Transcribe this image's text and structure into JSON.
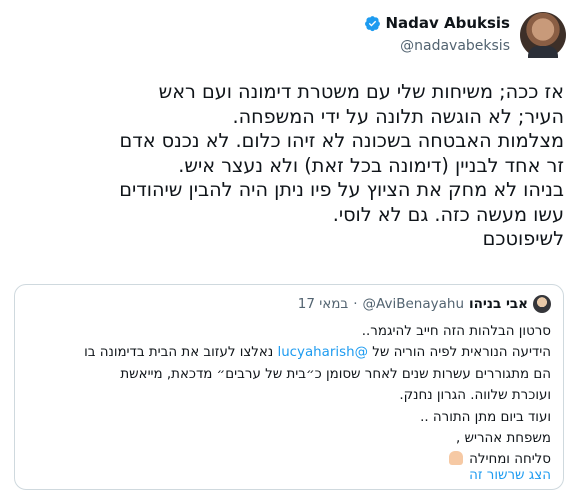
{
  "author": {
    "name": "Nadav Abuksis",
    "handle": "@nadavabeksis"
  },
  "tweet": {
    "lines": [
      "אז ככה; משיחות שלי עם משטרת דימונה ועם ראש",
      "העיר; לא הוגשה תלונה על ידי המשפחה.",
      "מצלמות האבטחה בשכונה לא זיהו כלום. לא נכנס אדם",
      "זר אחד לבניין (דימונה בכל זאת) ולא נעצר איש.",
      "בניהו לא מחק את הציוץ על פיו ניתן היה להבין שיהודים",
      "עשו מעשה כזה. גם לא לוסי.",
      "לשיפוטכם"
    ]
  },
  "quote": {
    "name": "אבי בניהו",
    "handle": "@AviBenayahu",
    "dot": "·",
    "date": "17 במאי",
    "lines": [
      {
        "pre": "סרטון הבלהות הזה חייב להיגמר..",
        "link": "",
        "post": ""
      },
      {
        "pre": "הידיעה הנוראית לפיה הוריה של ",
        "link": "@lucyaharish",
        "post": " נאלצו לעזוב את הבית בדימונה בו"
      },
      {
        "pre": "הם מתגוררים עשרות שנים  לאחר שסומן כ״בית של ערבים״ מדכאת, מייאשת",
        "link": "",
        "post": ""
      },
      {
        "pre": "ועוכרת שלווה. הגרון נחנק.",
        "link": "",
        "post": ""
      },
      {
        "pre": "ועוד ביום מתן התורה ..",
        "link": "",
        "post": ""
      },
      {
        "pre": "משפחת אהריש ,",
        "link": "",
        "post": ""
      },
      {
        "pre": "סליחה ומחילה",
        "link": "",
        "post": ""
      }
    ],
    "show_thread": "הצג שרשור זה"
  },
  "colors": {
    "link": "#1d9bf0",
    "muted": "#536471",
    "border": "#cfd9de"
  },
  "icons": {
    "verified": "verified-badge-icon",
    "emoji": "folded-hands-emoji"
  }
}
